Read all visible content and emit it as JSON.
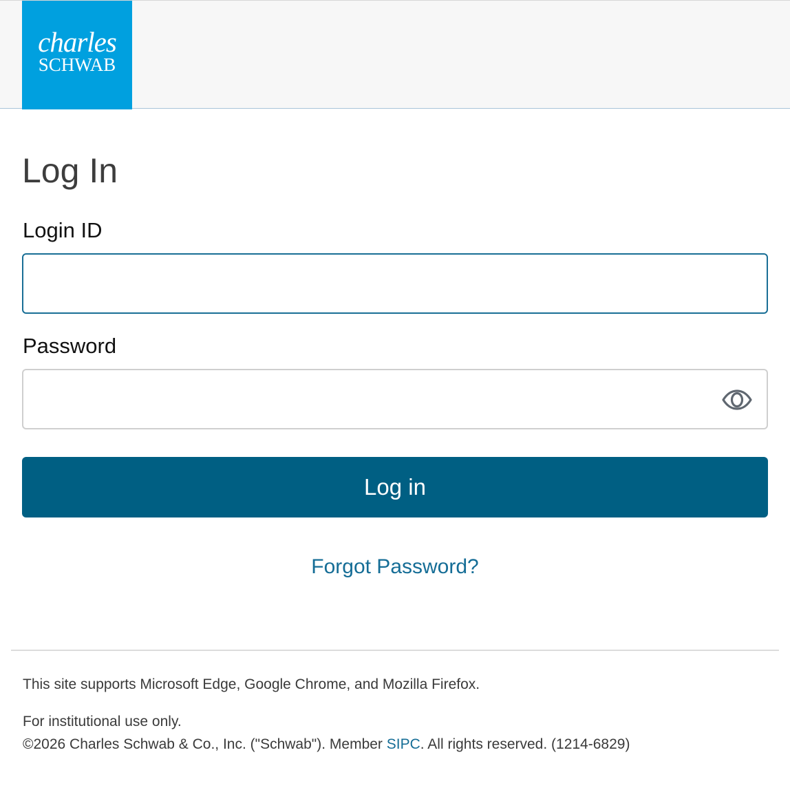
{
  "header": {
    "logo": {
      "line1": "charles",
      "line2": "SCHWAB",
      "background_color": "#00a0df"
    }
  },
  "login_form": {
    "title": "Log In",
    "login_id": {
      "label": "Login ID",
      "value": "",
      "placeholder": ""
    },
    "password": {
      "label": "Password",
      "value": "",
      "placeholder": "",
      "toggle_icon": "eye-icon"
    },
    "submit_label": "Log in",
    "submit_color": "#005f83",
    "forgot_password_label": "Forgot Password?",
    "link_color": "#156d96"
  },
  "footer": {
    "browser_support": "This site supports Microsoft Edge, Google Chrome, and Mozilla Firefox.",
    "institutional": "For institutional use only.",
    "copyright_prefix": "©2026 Charles Schwab & Co., Inc. (\"Schwab\"). Member ",
    "sipc_link": "SIPC",
    "copyright_suffix": ". All rights reserved. (1214-6829)"
  }
}
